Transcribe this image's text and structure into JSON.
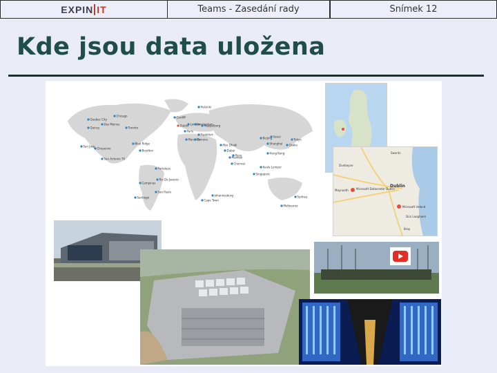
{
  "header": {
    "logo_main": "EXPIN",
    "logo_accent": "IT",
    "presentation_title": "Teams - Zasedání rady",
    "slide_number": "Snímek 12"
  },
  "slide": {
    "title": "Kde jsou data uložena"
  },
  "world_map": {
    "locations": [
      "Quincy",
      "Des Moines",
      "Chicago",
      "Toronto",
      "Quebec City",
      "Blue Ridge",
      "Boydton",
      "San Jose",
      "Cheyenne",
      "San Antonio TX",
      "Fortaleza",
      "Rio De Janeiro",
      "Campinas",
      "Sao Paulo",
      "Santiago",
      "Dublin",
      "Cardiff",
      "London",
      "Amsterdam",
      "Helsinki",
      "Meppelborg",
      "Paris",
      "Frankfurt",
      "Marseille",
      "Geneva",
      "Abu Dhabi",
      "Dubai",
      "Mumbai",
      "Chennai",
      "Pune",
      "Beijing",
      "Shanghai",
      "Seoul",
      "Tokyo",
      "Osaka",
      "Hong Kong",
      "Kuala Lumpur",
      "Singapore",
      "Johannesburg",
      "Cape Town",
      "Sydney",
      "Melbourne"
    ]
  },
  "map_dublin": {
    "labels": [
      "Swords",
      "Dunboyne",
      "Dublin",
      "Microsoft Datacenter Dublin",
      "Bray",
      "Maynooth",
      "Microsoft Ireland",
      "Dún Laoghaire"
    ]
  },
  "colors": {
    "background": "#e9ebf7",
    "heading": "#1f4e4a",
    "rule": "#1f2f30",
    "marker": "#e74c3c"
  }
}
